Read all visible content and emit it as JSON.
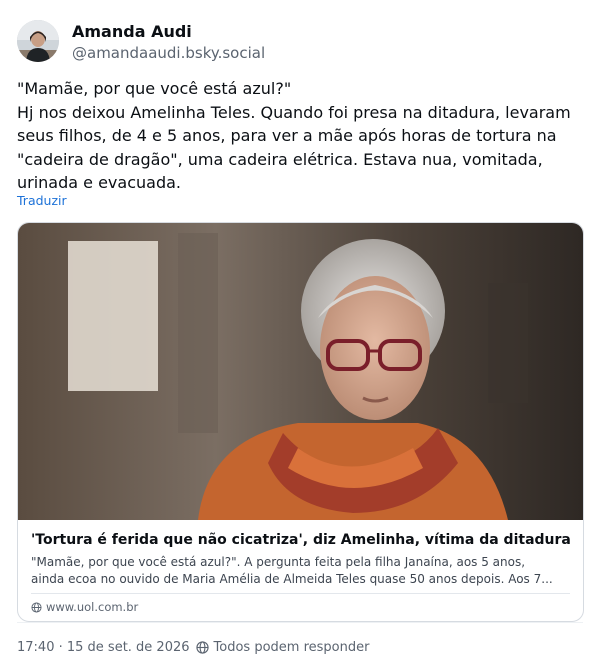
{
  "author": {
    "name": "Amanda Audi",
    "handle": "@amandaaudi.bsky.social"
  },
  "post": {
    "lines": [
      "\"Mamãe, por que você está azul?\"",
      "Hj nos deixou Amelinha Teles. Quando foi presa na ditadura, levaram",
      "seus filhos, de 4 e 5 anos, para ver a mãe após horas de tortura na",
      "\"cadeira de dragão\", uma cadeira elétrica. Estava nua, vomitada,",
      "urinada e evacuada."
    ],
    "translate_label": "Traduzir"
  },
  "link_card": {
    "title": "'Tortura é ferida que não cicatriza', diz Amelinha, vítima da ditadura",
    "description_lines": [
      "\"Mamãe, por que você está azul?\". A pergunta feita pela filha Janaína, aos 5 anos,",
      "ainda ecoa no ouvido de Maria Amélia de Almeida Teles quase 50 anos depois. Aos 7..."
    ],
    "domain": "www.uol.com.br",
    "image_icon": "portrait-photo"
  },
  "footer": {
    "timestamp": "17:40 · 15 de set. de 2026",
    "reply_setting": "Todos podem responder",
    "reply_icon": "globe-icon"
  },
  "colors": {
    "link": "#1d72d8",
    "muted": "#5b6470",
    "border": "#d6dbe1"
  }
}
